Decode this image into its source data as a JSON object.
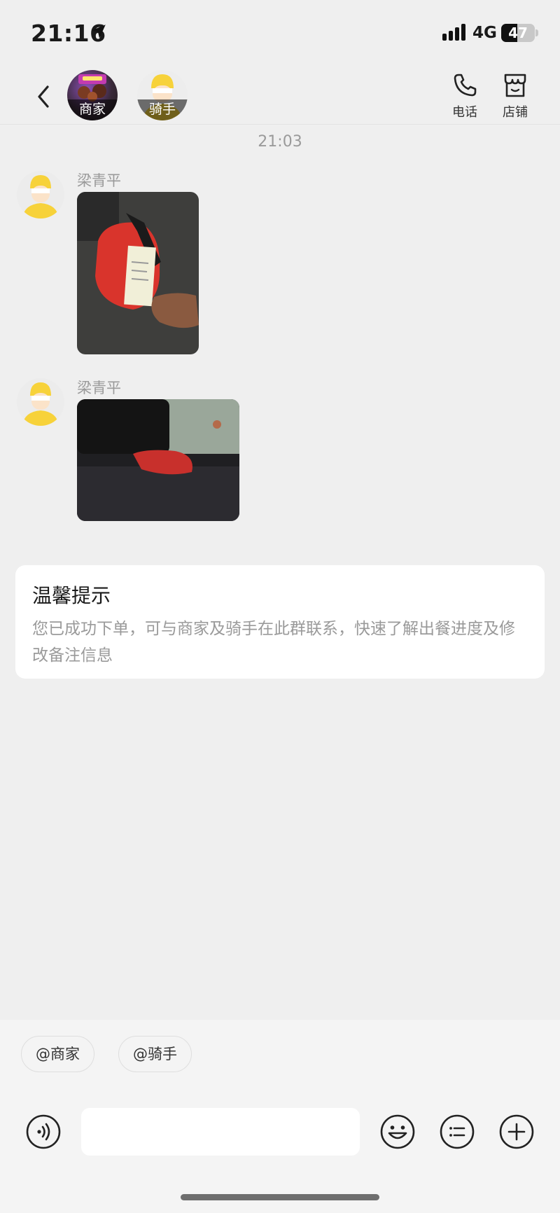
{
  "status_bar": {
    "time": "21:16",
    "network": "4G",
    "battery": "47",
    "battery_level": 0.47
  },
  "header": {
    "members": [
      {
        "label": "商家",
        "icon": "merchant-avatar"
      },
      {
        "label": "骑手",
        "icon": "rider-avatar"
      }
    ],
    "actions": [
      {
        "label": "电话",
        "icon": "phone-icon"
      },
      {
        "label": "店铺",
        "icon": "store-icon"
      }
    ]
  },
  "chat": {
    "timestamp": "21:03",
    "messages": [
      {
        "sender": "梁青平",
        "type": "image"
      },
      {
        "sender": "梁青平",
        "type": "image"
      }
    ]
  },
  "tip": {
    "title": "温馨提示",
    "body": "您已成功下单，可与商家及骑手在此群联系，快速了解出餐进度及修改备注信息"
  },
  "quick_mentions": [
    "@商家",
    "@骑手"
  ],
  "input": {
    "placeholder": ""
  },
  "colors": {
    "background": "#efefef",
    "card": "#ffffff",
    "muted_text": "#9a9a9a",
    "rider_yellow": "#f7d23a"
  }
}
